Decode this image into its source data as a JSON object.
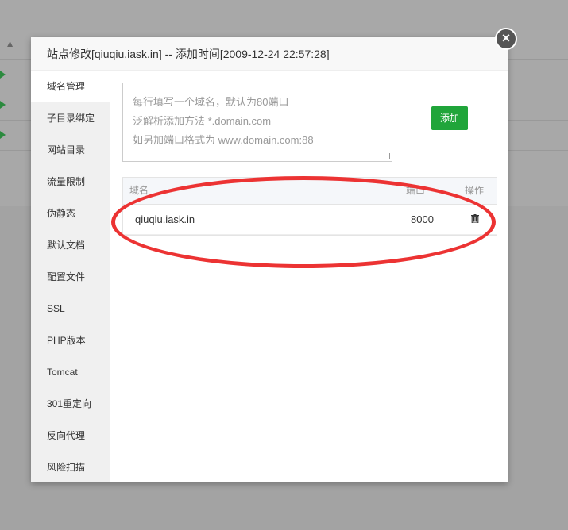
{
  "background": {
    "sort_icon": "sort-up-icon",
    "row_icon": "play-icon"
  },
  "dialog": {
    "title": "站点修改[qiuqiu.iask.in] -- 添加时间[2009-12-24 22:57:28]",
    "close_icon": "close-icon"
  },
  "sidebar": {
    "items": [
      {
        "label": "域名管理",
        "active": true
      },
      {
        "label": "子目录绑定"
      },
      {
        "label": "网站目录"
      },
      {
        "label": "流量限制"
      },
      {
        "label": "伪静态"
      },
      {
        "label": "默认文档"
      },
      {
        "label": "配置文件"
      },
      {
        "label": "SSL"
      },
      {
        "label": "PHP版本"
      },
      {
        "label": "Tomcat"
      },
      {
        "label": "301重定向"
      },
      {
        "label": "反向代理"
      },
      {
        "label": "风险扫描"
      }
    ]
  },
  "domain_input": {
    "placeholder_lines": [
      "每行填写一个域名，默认为80端口",
      "泛解析添加方法 *.domain.com",
      "如另加端口格式为 www.domain.com:88"
    ]
  },
  "add_button": {
    "label": "添加"
  },
  "table": {
    "headers": {
      "domain": "域名",
      "port": "端口",
      "action": "操作"
    },
    "rows": [
      {
        "domain": "qiuqiu.iask.in",
        "port": "8000",
        "action_icon": "trash-icon"
      }
    ]
  },
  "colors": {
    "accent": "#20a53a",
    "annotation": "#ec3333"
  }
}
